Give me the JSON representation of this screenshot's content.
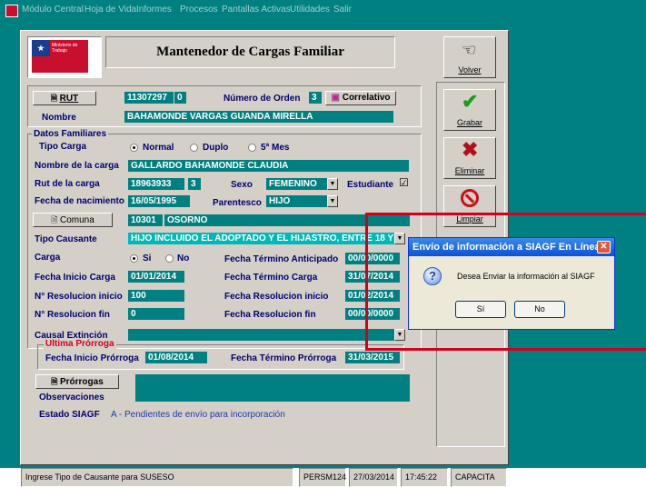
{
  "menu": {
    "items": [
      "Módulo Central",
      "Hoja de Vida",
      "Informes",
      "Procesos",
      "Pantallas Activas",
      "Utilidades",
      "Salir"
    ]
  },
  "header": {
    "title": "Mantenedor de Cargas Familiar",
    "logo_text": "Ministerio de Trabajo"
  },
  "side_buttons": {
    "volver": "Volver",
    "grabar": "Grabar",
    "eliminar": "Eliminar",
    "limpiar": "Limpiar"
  },
  "worker": {
    "rut_button": "RUT",
    "rut_value": "11307297",
    "rut_dv": "0",
    "orden_label": "Número de Orden",
    "orden_value": "3",
    "correlativo_button": "Correlativo",
    "nombre_label": "Nombre",
    "nombre_value": "BAHAMONDE VARGAS GUANDA MIRELLA"
  },
  "familiares": {
    "section_label": "Datos Familiares",
    "tipo_carga_label": "Tipo Carga",
    "tipo_carga_options": [
      "Normal",
      "Duplo",
      "5ª Mes"
    ],
    "tipo_carga_selected": "Normal",
    "nombre_carga_label": "Nombre de la carga",
    "nombre_carga_value": "GALLARDO BAHAMONDE CLAUDIA",
    "rut_carga_label": "Rut de la carga",
    "rut_carga_value": "18963933",
    "rut_carga_dv": "3",
    "sexo_label": "Sexo",
    "sexo_value": "FEMENINO",
    "estudiante_label": "Estudiante",
    "estudiante_checked": "☑",
    "fecha_nac_label": "Fecha de nacimiento",
    "fecha_nac_value": "16/05/1995",
    "parentesco_label": "Parentesco",
    "parentesco_value": "HIJO",
    "comuna_button": "Comuna",
    "comuna_code": "10301",
    "comuna_name": "OSORNO",
    "tipo_causante_label": "Tipo Causante",
    "tipo_causante_value": "HIJO INCLUIDO EL ADOPTADO Y EL HIJASTRO, ENTRE 18 Y",
    "carga_label": "Carga",
    "carga_options": [
      "Si",
      "No"
    ],
    "carga_selected": "Si",
    "fecha_inicio_carga_label": "Fecha Inicio Carga",
    "fecha_inicio_carga_value": "01/01/2014",
    "resol_inicio_label": "N° Resolucion inicio",
    "resol_inicio_value": "100",
    "resol_fin_label": "N° Resolucion fin",
    "resol_fin_value": "0",
    "termino_anticipado_label": "Fecha Término Anticipado",
    "termino_anticipado_value": "00/00/0000",
    "termino_carga_label": "Fecha Término Carga",
    "termino_carga_value": "31/07/2014",
    "fecha_resol_inicio_label": "Fecha Resolucion inicio",
    "fecha_resol_inicio_value": "01/02/2014",
    "fecha_resol_fin_label": "Fecha Resolucion fin",
    "fecha_resol_fin_value": "00/00/0000",
    "causal_label": "Causal Extinción",
    "causal_value": ""
  },
  "prorroga": {
    "section_label": "Ultima Prórroga",
    "inicio_label": "Fecha Inicio Prórroga",
    "inicio_value": "01/08/2014",
    "termino_label": "Fecha Término Prórroga",
    "termino_value": "31/03/2015",
    "button": "Prórrogas",
    "observaciones_label": "Observaciones",
    "estado_label": "Estado SIAGF",
    "estado_value": "A - Pendientes de envío para incorporación"
  },
  "statusbar": {
    "message": "Ingrese Tipo de Causante para SUSESO",
    "code": "PERSM124",
    "date": "27/03/2014",
    "time": "17:45:22",
    "mode": "CAPACITA"
  },
  "dialog": {
    "title": "Envío de información a SIAGF En Línea",
    "message": "Desea Enviar la información al SIAGF",
    "yes": "Sí",
    "no": "No"
  },
  "colors": {
    "teal": "#008080",
    "highlight_frame": "#d2001e"
  }
}
